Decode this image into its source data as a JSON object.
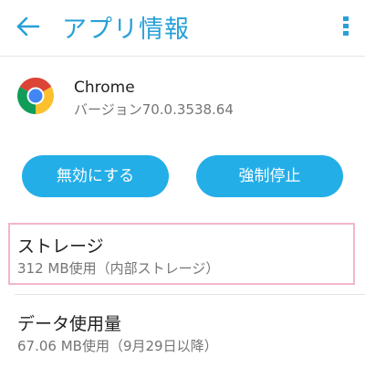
{
  "header": {
    "title": "アプリ情報",
    "back_icon": "back-arrow-icon",
    "overflow_icon": "more-vert-icon",
    "accent_color": "#27a0d8"
  },
  "app": {
    "name": "Chrome",
    "version": "バージョン70.0.3538.64",
    "icon": "chrome-logo-icon"
  },
  "actions": {
    "disable_label": "無効にする",
    "force_stop_label": "強制停止",
    "button_color": "#24aee8"
  },
  "storage": {
    "title": "ストレージ",
    "summary": "312 MB使用（内部ストレージ）"
  },
  "data_usage": {
    "title": "データ使用量",
    "summary": "67.06 MB使用（9月29日以降）"
  }
}
